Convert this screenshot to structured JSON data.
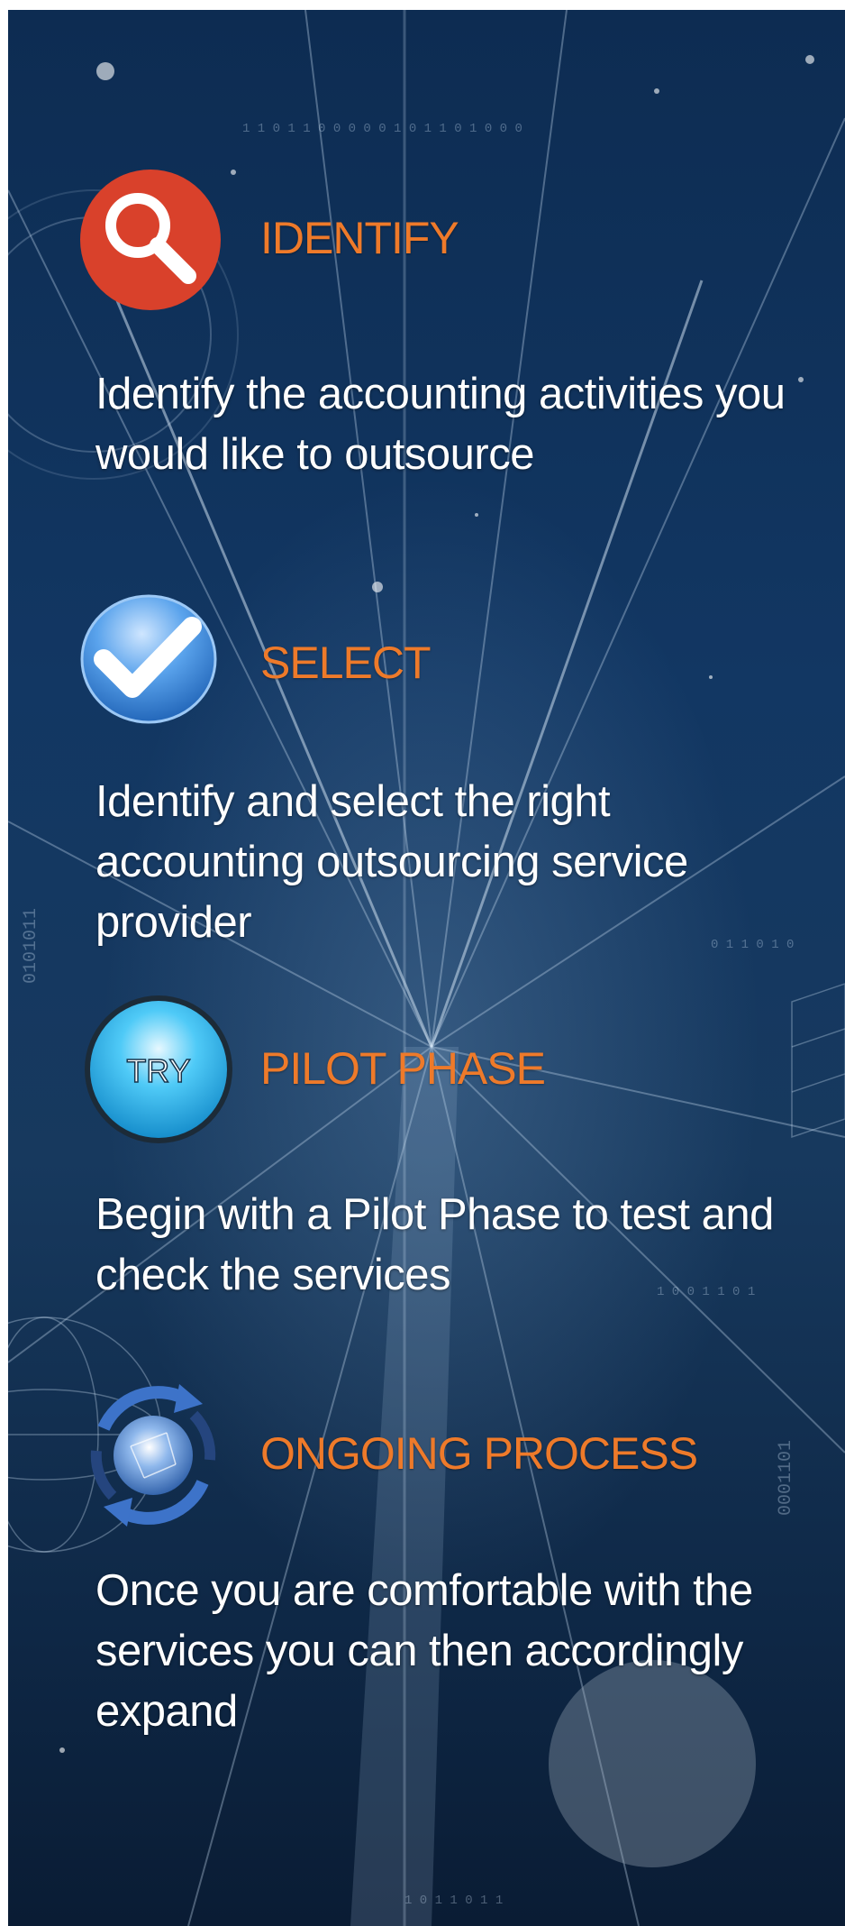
{
  "steps": [
    {
      "icon": "magnifier-icon",
      "title": "IDENTIFY",
      "description": "Identify the accounting activities you would like to outsource"
    },
    {
      "icon": "checkmark-icon",
      "title": "SELECT",
      "description": "Identify and select the right accounting outsourcing service provider"
    },
    {
      "icon": "try-button-icon",
      "icon_label": "TRY",
      "title": "PILOT PHASE",
      "description": "Begin with a Pilot Phase to test and check the services"
    },
    {
      "icon": "globe-cycle-icon",
      "title": "ONGOING PROCESS",
      "description": "Once you are comfortable with the services you can then accordingly expand"
    }
  ],
  "colors": {
    "title": "#ee7a2a",
    "text": "#ffffff",
    "background": "#123763",
    "magnifier_circle": "#d9412b",
    "check_ball": "#3a86d8",
    "try_ball": "#28b6f0"
  }
}
